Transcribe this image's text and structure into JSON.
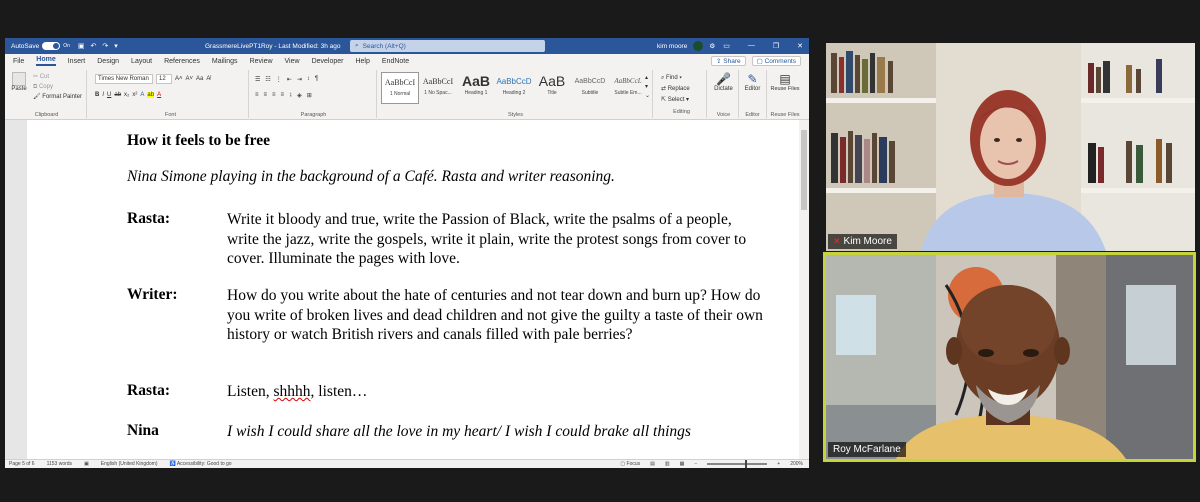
{
  "word": {
    "titlebar": {
      "autosave": "AutoSave",
      "toggle_state": "On",
      "doc_title": "GrassmereLivePT1Roy  -  Last Modified: 3h ago",
      "search_placeholder": "Search (Alt+Q)",
      "user_name": "kim moore"
    },
    "tabs": [
      "File",
      "Home",
      "Insert",
      "Design",
      "Layout",
      "References",
      "Mailings",
      "Review",
      "View",
      "Developer",
      "Help",
      "EndNote"
    ],
    "active_tab": "Home",
    "share_label": "Share",
    "comments_label": "Comments",
    "ribbon": {
      "clipboard": {
        "paste": "Paste",
        "cut": "Cut",
        "copy": "Copy",
        "format_painter": "Format Painter",
        "label": "Clipboard"
      },
      "font": {
        "name": "Times New Roman",
        "size": "12",
        "label": "Font"
      },
      "paragraph": {
        "label": "Paragraph"
      },
      "styles": {
        "label": "Styles",
        "items": [
          {
            "sample": "AaBbCcI",
            "name": "1 Normal"
          },
          {
            "sample": "AaBbCcI",
            "name": "1 No Spac..."
          },
          {
            "sample": "AaB",
            "name": "Heading 1"
          },
          {
            "sample": "AaBbCcD",
            "name": "Heading 2"
          },
          {
            "sample": "AaB",
            "name": "Title"
          },
          {
            "sample": "AaBbCcD",
            "name": "Subtitle"
          },
          {
            "sample": "AaBbCcL",
            "name": "Subtle Em..."
          }
        ]
      },
      "editing": {
        "find": "Find",
        "replace": "Replace",
        "select": "Select",
        "label": "Editing"
      },
      "voice": {
        "dictate": "Dictate",
        "label": "Voice"
      },
      "editor": {
        "editor": "Editor",
        "label": "Editor"
      },
      "reuse": {
        "reuse": "Reuse Files",
        "label": "Reuse Files"
      }
    },
    "document": {
      "title": "How it feels to be free",
      "stage_direction": "Nina Simone playing in the background of a Café. Rasta and writer reasoning.",
      "lines": [
        {
          "speaker": "Rasta:",
          "text": "Write it bloody and true, write the Passion of Black, write the psalms of a people, write the jazz, write the gospels, write it plain, write the protest songs from cover to cover. Illuminate the pages with love."
        },
        {
          "speaker": "Writer:",
          "text": "How do you write about the hate of centuries and not tear down and burn up? How do you write of broken lives and dead children and not give the guilty a taste of their own history or watch British rivers and canals filled with pale berries?"
        },
        {
          "speaker": "Rasta:",
          "text_pre": "Listen, ",
          "text_wavy": "shhhh",
          "text_post": ", listen…"
        },
        {
          "speaker": "Nina",
          "text": "I wish I could share all the love in my heart/ I wish I could brake all things"
        }
      ]
    },
    "status": {
      "page": "Page 5 of 6",
      "words": "1153 words",
      "language": "English (United Kingdom)",
      "accessibility": "Accessibility: Good to go",
      "focus": "Focus",
      "zoom": "200%"
    }
  },
  "participants": [
    {
      "name": "Kim Moore",
      "muted": true
    },
    {
      "name": "Roy McFarlane",
      "muted": false,
      "active_speaker": true
    }
  ]
}
